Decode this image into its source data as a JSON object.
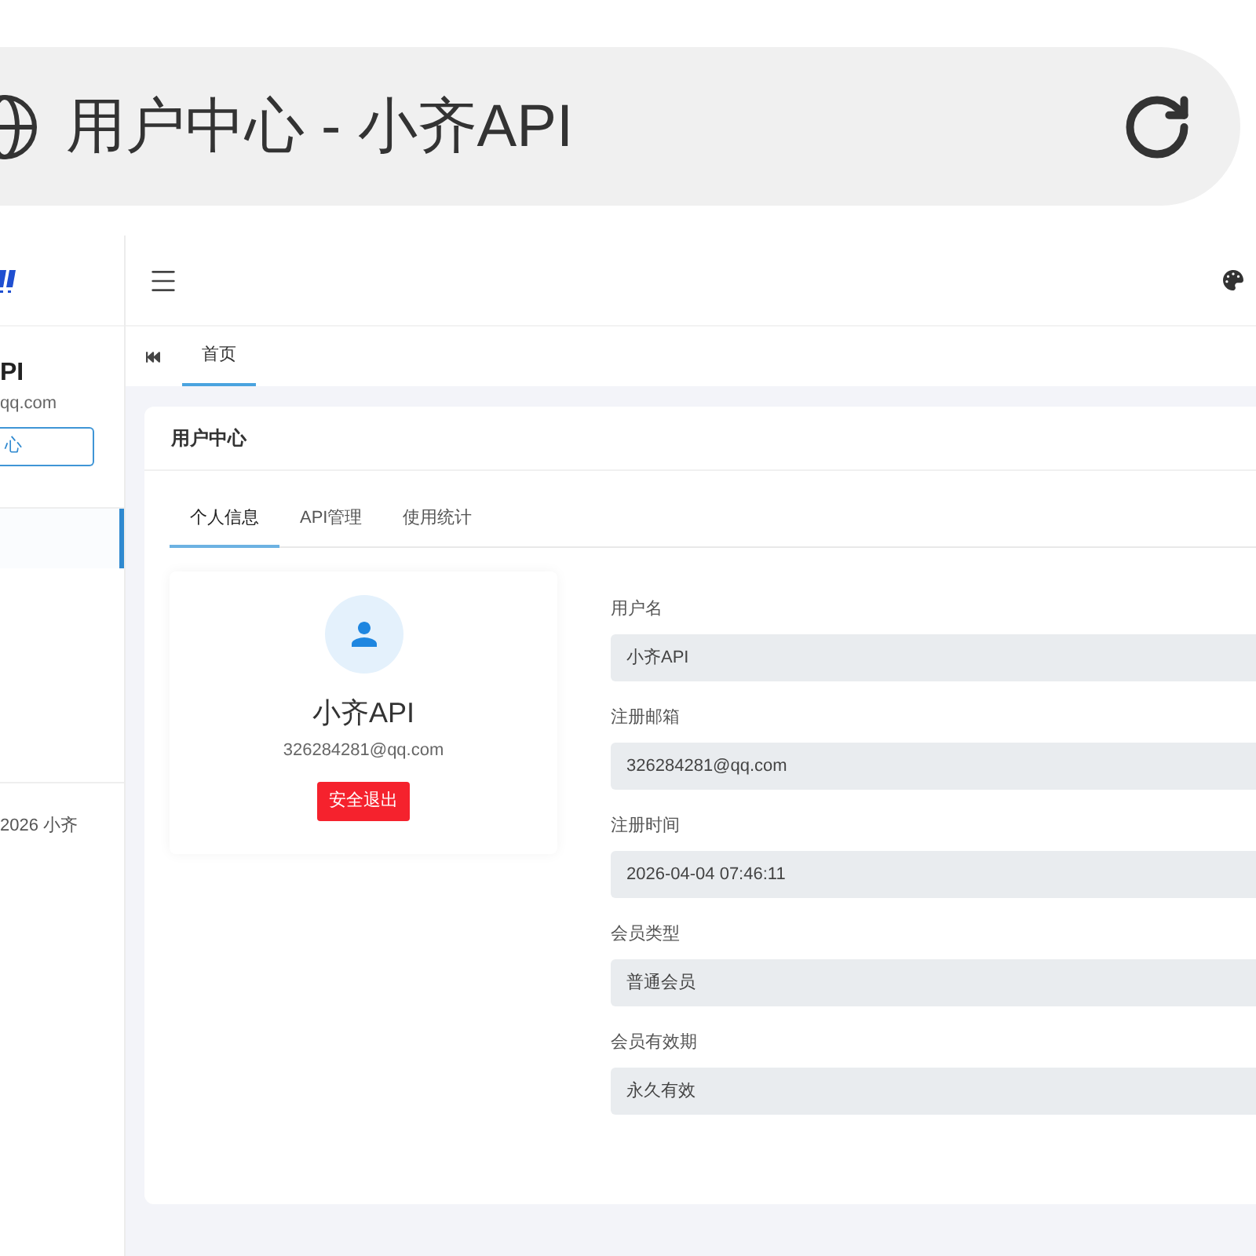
{
  "browser": {
    "page_title": "用户中心 - 小齐API"
  },
  "sidebar": {
    "user_name": "PI",
    "user_email": "qq.com",
    "user_center_button": "心",
    "nav_items": [
      {
        "selected": true
      }
    ],
    "footer": "2026 小齐"
  },
  "tab_bar": {
    "tabs": [
      {
        "label": "首页",
        "selected": true
      }
    ]
  },
  "card": {
    "title": "用户中心",
    "tabs": [
      {
        "label": "个人信息",
        "selected": true
      },
      {
        "label": "API管理",
        "selected": false
      },
      {
        "label": "使用统计",
        "selected": false
      }
    ],
    "profile": {
      "name": "小齐API",
      "email": "326284281@qq.com",
      "logout_button": "安全退出"
    },
    "fields": [
      {
        "label": "用户名",
        "value": "小齐API"
      },
      {
        "label": "注册邮箱",
        "value": "326284281@qq.com"
      },
      {
        "label": "注册时间",
        "value": "2026-04-04 07:46:11"
      },
      {
        "label": "会员类型",
        "value": "普通会员"
      },
      {
        "label": "会员有效期",
        "value": "永久有效"
      }
    ]
  }
}
